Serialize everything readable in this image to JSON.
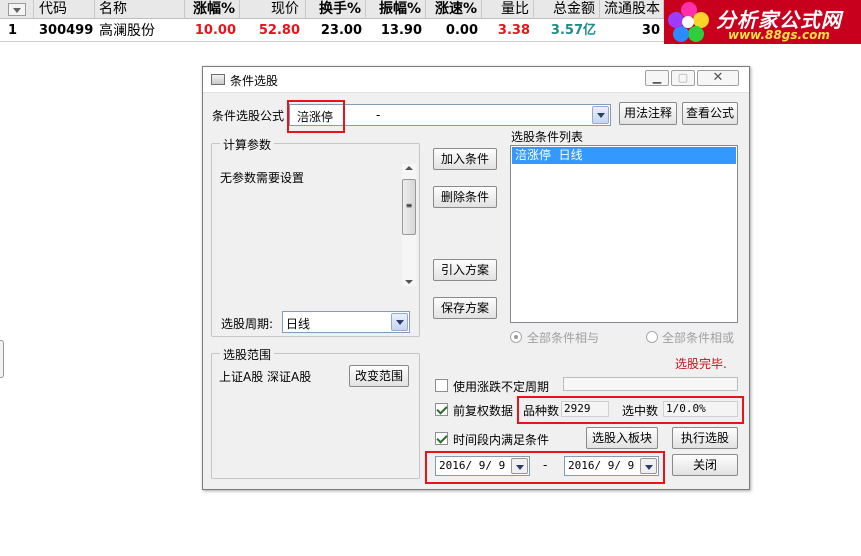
{
  "table": {
    "headers": [
      "代码",
      "名称",
      "涨幅%",
      "现价",
      "换手%",
      "振幅%",
      "涨速%",
      "量比",
      "总金额",
      "流通股本"
    ],
    "row": {
      "index": "1",
      "code": "300499",
      "name": "高澜股份",
      "change": "10.00",
      "price": "52.80",
      "turnover": "23.00",
      "amplitude": "13.90",
      "speed": "0.00",
      "volume_ratio": "3.38",
      "amount": "3.57亿",
      "float_shares": "30"
    }
  },
  "logo": {
    "text": "分析家公式网",
    "url": "www.88gs.com"
  },
  "dialog": {
    "title": "条件选股",
    "formula_label": "条件选股公式",
    "formula_value": "涪涨停",
    "formula_dash": "-",
    "usage_button": "用法注释",
    "view_button": "查看公式",
    "params_group": "计算参数",
    "params_text": "无参数需要设置",
    "add_button": "加入条件",
    "delete_button": "删除条件",
    "import_button": "引入方案",
    "save_button": "保存方案",
    "list_label": "选股条件列表",
    "list_items": [
      "涪涨停  日线"
    ],
    "period_label": "选股周期:",
    "period_value": "日线",
    "all_and": "全部条件相与",
    "all_or": "全部条件相或",
    "status": "选股完毕.",
    "range_group": "选股范围",
    "range_text": "上证A股 深证A股",
    "change_range_button": "改变范围",
    "use_uncertain": "使用涨跌不定周期",
    "pre_adjust": "前复权数据",
    "count_label": "品种数",
    "count_value": "2929",
    "selected_label": "选中数",
    "selected_value": "1/0.0%",
    "time_period": "时间段内满足条件",
    "to_block_button": "选股入板块",
    "execute_button": "执行选股",
    "date_from": "2016/ 9/ 9",
    "date_sep": "-",
    "date_to": "2016/ 9/ 9",
    "close_button": "关闭",
    "colors": {
      "red": "#e8141a",
      "selection": "#3399ff"
    }
  }
}
